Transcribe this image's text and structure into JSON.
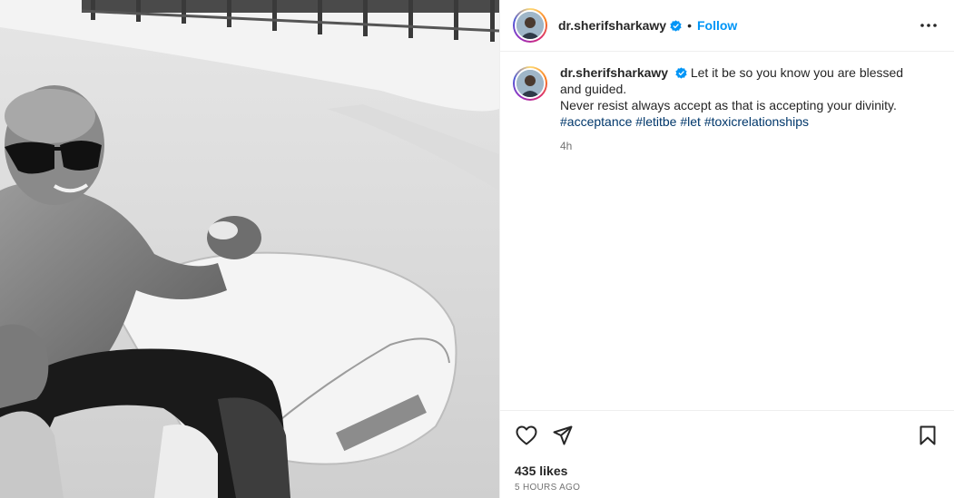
{
  "post": {
    "username": "dr.sherifsharkawy",
    "follow_label": "Follow",
    "dot": "•",
    "caption_line1": "Let it be so you know you are blessed and guided.",
    "caption_line2": "Never resist always accept as that is accepting your divinity.",
    "hashtags": [
      "#acceptance",
      "#letitbe",
      "#let",
      "#toxicrelationships"
    ],
    "time_ago": "4h",
    "likes": "435 likes",
    "date": "5 HOURS AGO"
  },
  "icons": {
    "verified": "verified-badge-icon",
    "more": "more-options-icon",
    "like": "heart-icon",
    "share": "paper-plane-icon",
    "save": "bookmark-icon"
  },
  "colors": {
    "follow": "#0095f6",
    "hashtag": "#00376b",
    "verified": "#0095f6",
    "muted": "#737373"
  }
}
